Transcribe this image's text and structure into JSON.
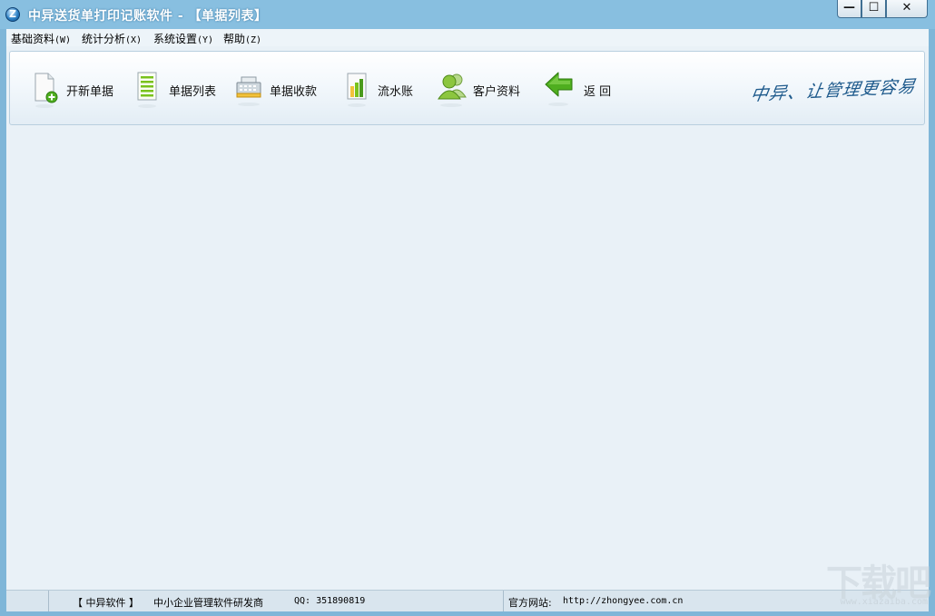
{
  "window": {
    "title": "中异送货单打印记账软件 - 【单据列表】",
    "controls": {
      "minimize": "—",
      "maximize": "☐",
      "close": "✕"
    }
  },
  "menubar": [
    {
      "label": "基础资料",
      "accel": "(W)"
    },
    {
      "label": "统计分析",
      "accel": "(X)"
    },
    {
      "label": "系统设置",
      "accel": "(Y)"
    },
    {
      "label": "帮助",
      "accel": "(Z)"
    }
  ],
  "toolbar": [
    {
      "label": "开新单据",
      "icon": "new-document-icon"
    },
    {
      "label": "单据列表",
      "icon": "document-list-icon"
    },
    {
      "label": "单据收款",
      "icon": "cash-register-icon"
    },
    {
      "label": "流水账",
      "icon": "ledger-icon"
    },
    {
      "label": "客户资料",
      "icon": "customers-icon"
    },
    {
      "label": "返 回",
      "icon": "back-arrow-icon"
    }
  ],
  "brand_slogan": "中异、让管理更容易",
  "statusbar": {
    "company": "【 中异软件 】",
    "tagline": "中小企业管理软件研发商",
    "qq": "QQ: 351890819",
    "website_label": "官方网站:",
    "website_url": "http://zhongyee.com.cn"
  },
  "watermark": {
    "main": "下载吧",
    "sub": "www.xiazaiba.com"
  },
  "colors": {
    "titlebar": "#88bfe0",
    "client_bg": "#e9f1f7",
    "accent_green": "#4fae1f",
    "brand_blue": "#1e5a8c"
  }
}
